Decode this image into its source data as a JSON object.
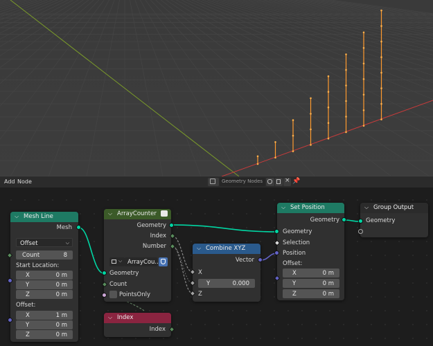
{
  "header": {
    "menu_add": "Add",
    "menu_node": "Node",
    "node_tree_name": "Geometry Nodes"
  },
  "nodes": {
    "mesh_line": {
      "title": "Mesh Line",
      "out_mesh": "Mesh",
      "mode": "Offset",
      "count_label": "Count",
      "count_value": "8",
      "start_location_label": "Start Location:",
      "offset_label": "Offset:",
      "start": [
        {
          "axis": "X",
          "value": "0 m"
        },
        {
          "axis": "Y",
          "value": "0 m"
        },
        {
          "axis": "Z",
          "value": "0 m"
        }
      ],
      "offset": [
        {
          "axis": "X",
          "value": "1 m"
        },
        {
          "axis": "Y",
          "value": "0 m"
        },
        {
          "axis": "Z",
          "value": "0 m"
        }
      ]
    },
    "array_counter": {
      "title": "ArrayCounter",
      "out_geometry": "Geometry",
      "out_index": "Index",
      "out_number": "Number",
      "group_name": "ArrayCou...",
      "in_geometry": "Geometry",
      "in_count": "Count",
      "in_points_only": "PointsOnly"
    },
    "combine_xyz": {
      "title": "Combine XYZ",
      "out_vector": "Vector",
      "in_x": "X",
      "in_y": "Y",
      "y_value": "0.000",
      "in_z": "Z"
    },
    "set_position": {
      "title": "Set Position",
      "out_geometry": "Geometry",
      "in_geometry": "Geometry",
      "in_selection": "Selection",
      "in_position": "Position",
      "offset_label": "Offset:",
      "offset": [
        {
          "axis": "X",
          "value": "0 m"
        },
        {
          "axis": "Y",
          "value": "0 m"
        },
        {
          "axis": "Z",
          "value": "0 m"
        }
      ]
    },
    "group_output": {
      "title": "Group Output",
      "in_geometry": "Geometry"
    },
    "index": {
      "title": "Index",
      "out_index": "Index"
    }
  },
  "colors": {
    "geometry_header": "#1e7a63",
    "group_header": "#3b5a28",
    "vector_header": "#2a5a8c",
    "input_header": "#8a2440",
    "output_header": "#2b2b2b",
    "geometry_socket": "#00d6a3",
    "column_color": "#ff9a2e",
    "axis_x": "#c73b3b",
    "axis_y": "#7a9a2a"
  },
  "viewport": {
    "column_heights": [
      0.5,
      1,
      2,
      3,
      4,
      5,
      6,
      7
    ]
  }
}
